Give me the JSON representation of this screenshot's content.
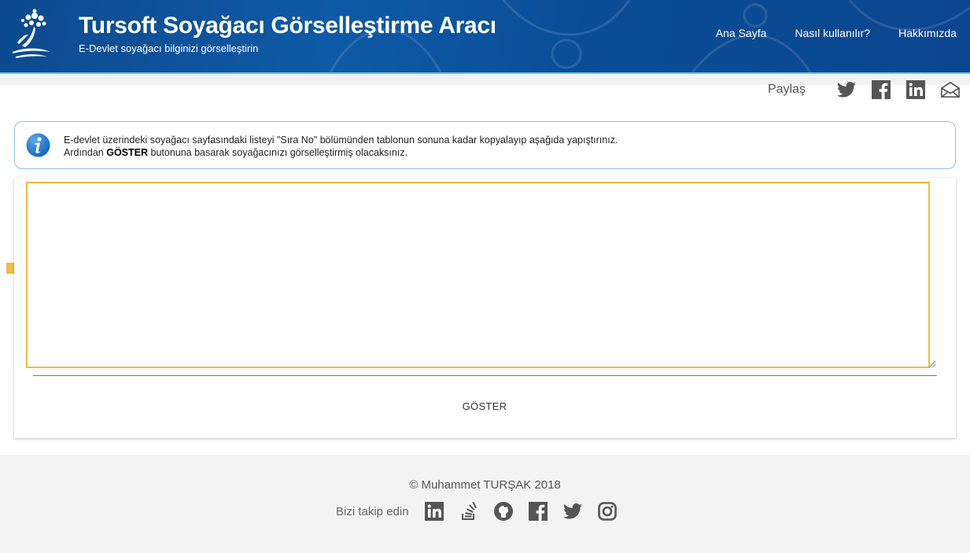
{
  "header": {
    "title": "Tursoft Soyağacı Görselleştirme Aracı",
    "subtitle": "E-Devlet soyağacı bilginizi görselleştirin",
    "nav": [
      "Ana Sayfa",
      "Nasıl kullanılır?",
      "Hakkımızda"
    ],
    "colors": {
      "background": "#0d4a8f",
      "accent": "#5fc7e8"
    }
  },
  "share": {
    "label": "Paylaş",
    "icons": [
      "twitter-icon",
      "facebook-icon",
      "linkedin-icon",
      "email-icon"
    ]
  },
  "info": {
    "line1": "E-devlet üzerindeki soyağacı sayfasındaki listeyi \"Sıra No\" bölümünden tablonun sonuna kadar kopyalayıp aşağıda yapıştırınız.",
    "line2_prefix": "Ardından ",
    "line2_bold": "GÖSTER",
    "line2_suffix": " butonuna basarak soyağacınızı görselleştirmiş olacaksınız.",
    "colors": {
      "border": "#8fc1e6",
      "icon": "#1f78d1"
    }
  },
  "form": {
    "textarea_value": "",
    "textarea_placeholder": "",
    "submit_label": "GÖSTER",
    "colors": {
      "highlight": "#f5b93d"
    }
  },
  "footer": {
    "copyright": "© Muhammet TURŞAK 2018",
    "follow_label": "Bizi takip edin",
    "icons": [
      "linkedin-icon",
      "stackoverflow-icon",
      "github-icon",
      "facebook-icon",
      "twitter-icon",
      "instagram-icon"
    ]
  }
}
